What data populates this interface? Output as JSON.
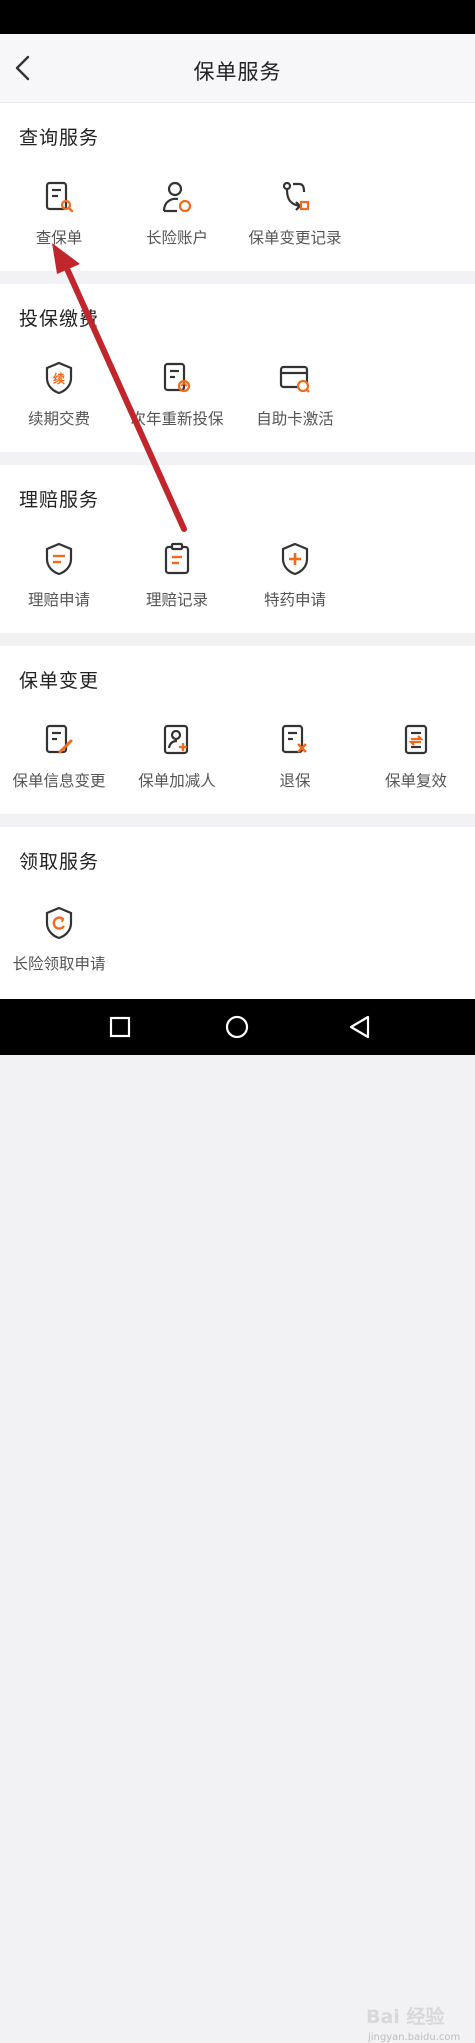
{
  "header": {
    "title": "保单服务"
  },
  "sections": [
    {
      "title": "查询服务",
      "items": [
        {
          "label": "查保单",
          "icon": "policy-search-icon"
        },
        {
          "label": "长险账户",
          "icon": "user-account-icon"
        },
        {
          "label": "保单变更记录",
          "icon": "change-record-icon"
        }
      ]
    },
    {
      "title": "投保缴费",
      "items": [
        {
          "label": "续期交费",
          "icon": "renewal-shield-icon"
        },
        {
          "label": "次年重新投保",
          "icon": "reinsure-doc-icon"
        },
        {
          "label": "自助卡激活",
          "icon": "card-activate-icon"
        }
      ]
    },
    {
      "title": "理赔服务",
      "items": [
        {
          "label": "理赔申请",
          "icon": "claim-shield-icon"
        },
        {
          "label": "理赔记录",
          "icon": "claim-clipboard-icon"
        },
        {
          "label": "特药申请",
          "icon": "medicine-shield-icon"
        }
      ]
    },
    {
      "title": "保单变更",
      "items": [
        {
          "label": "保单信息变更",
          "icon": "edit-doc-icon"
        },
        {
          "label": "保单加减人",
          "icon": "add-remove-person-icon"
        },
        {
          "label": "退保",
          "icon": "cancel-doc-icon"
        },
        {
          "label": "保单复效",
          "icon": "reinstate-doc-icon"
        }
      ]
    },
    {
      "title": "领取服务",
      "items": [
        {
          "label": "长险领取申请",
          "icon": "collect-shield-icon"
        }
      ]
    }
  ],
  "renewal_badge": "续",
  "watermark": {
    "text": "Bai 经验",
    "sub": "jingyan.baidu.com"
  },
  "colors": {
    "accent": "#f26b1d",
    "icon_dark": "#333333",
    "arrow": "#c0262b"
  }
}
